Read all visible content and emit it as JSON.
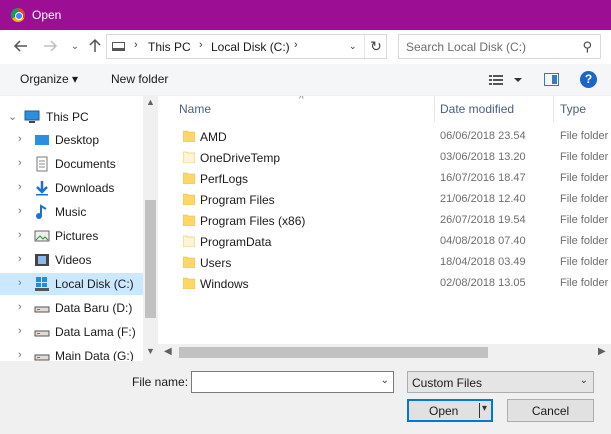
{
  "window": {
    "title": "Open",
    "app_icon": "chrome-icon",
    "titlebar_color": "#9c0f95"
  },
  "nav": {
    "back_icon": "arrow-left-icon",
    "forward_icon": "arrow-right-icon",
    "recent_icon": "chevron-down-icon",
    "up_icon": "arrow-up-icon",
    "address": {
      "crumbs": [
        "This PC",
        "Local Disk (C:)"
      ],
      "refresh_icon": "refresh-icon"
    },
    "search": {
      "placeholder": "Search Local Disk (C:)",
      "icon": "search-icon"
    }
  },
  "toolbar": {
    "organize_label": "Organize ▾",
    "new_folder_label": "New folder",
    "help_label": "?"
  },
  "sidebar": {
    "root": {
      "label": "This PC",
      "icon": "computer-icon"
    },
    "items": [
      {
        "label": "Desktop",
        "icon": "desktop-icon"
      },
      {
        "label": "Documents",
        "icon": "documents-icon"
      },
      {
        "label": "Downloads",
        "icon": "downloads-icon"
      },
      {
        "label": "Music",
        "icon": "music-icon"
      },
      {
        "label": "Pictures",
        "icon": "pictures-icon"
      },
      {
        "label": "Videos",
        "icon": "videos-icon"
      },
      {
        "label": "Local Disk (C:)",
        "icon": "windows-drive-icon",
        "selected": true
      },
      {
        "label": "Data Baru (D:)",
        "icon": "drive-icon"
      },
      {
        "label": "Data Lama (F:)",
        "icon": "drive-icon"
      },
      {
        "label": "Main Data (G:)",
        "icon": "drive-icon"
      }
    ]
  },
  "files": {
    "columns": {
      "name": "Name",
      "date": "Date modified",
      "type": "Type"
    },
    "rows": [
      {
        "name": "AMD",
        "date": "06/06/2018 23.54",
        "type": "File folder",
        "hidden": false
      },
      {
        "name": "OneDriveTemp",
        "date": "03/06/2018 13.20",
        "type": "File folder",
        "hidden": true
      },
      {
        "name": "PerfLogs",
        "date": "16/07/2016 18.47",
        "type": "File folder",
        "hidden": false
      },
      {
        "name": "Program Files",
        "date": "21/06/2018 12.40",
        "type": "File folder",
        "hidden": false
      },
      {
        "name": "Program Files (x86)",
        "date": "26/07/2018 19.54",
        "type": "File folder",
        "hidden": false
      },
      {
        "name": "ProgramData",
        "date": "04/08/2018 07.40",
        "type": "File folder",
        "hidden": true
      },
      {
        "name": "Users",
        "date": "18/04/2018 03.49",
        "type": "File folder",
        "hidden": false
      },
      {
        "name": "Windows",
        "date": "02/08/2018 13.05",
        "type": "File folder",
        "hidden": false
      }
    ]
  },
  "bottom": {
    "file_name_label": "File name:",
    "file_name_value": "",
    "filter_value": "Custom Files",
    "open_label": "Open",
    "cancel_label": "Cancel"
  },
  "colors": {
    "folder": "#ffd768",
    "folder_hidden": "#fff4d6",
    "selection": "#cce8ff",
    "accent": "#0078d7"
  }
}
